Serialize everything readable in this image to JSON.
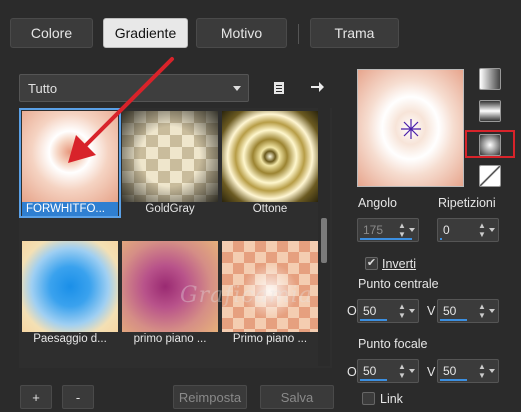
{
  "tabs": [
    {
      "label": "Colore"
    },
    {
      "label": "Gradiente"
    },
    {
      "label": "Motivo"
    },
    {
      "label": "Trama"
    }
  ],
  "library": {
    "category": "Tutto",
    "items": [
      {
        "caption": "FORWHITFO..."
      },
      {
        "caption": "GoldGray"
      },
      {
        "caption": "Ottone"
      },
      {
        "caption": "Paesaggio d..."
      },
      {
        "caption": "primo piano ..."
      },
      {
        "caption": "Primo piano ..."
      }
    ]
  },
  "footer": {
    "add_label": "+",
    "remove_label": "-",
    "reset_label": "Reimposta",
    "save_label": "Salva"
  },
  "properties": {
    "angle_label": "Angolo",
    "angle_value": "175",
    "repeats_label": "Ripetizioni",
    "repeats_value": "0",
    "invert_label": "Inverti",
    "invert_checked": "✔",
    "center_label": "Punto centrale",
    "center_o_label": "O",
    "center_o_value": "50",
    "center_v_label": "V",
    "center_v_value": "50",
    "focal_label": "Punto focale",
    "focal_o_label": "O",
    "focal_o_value": "50",
    "focal_v_label": "V",
    "focal_v_value": "50",
    "link_label": "Link"
  },
  "watermark": "Graficamia",
  "colors": {
    "accent": "#2f7fd1",
    "highlight_box": "#d8232a"
  }
}
